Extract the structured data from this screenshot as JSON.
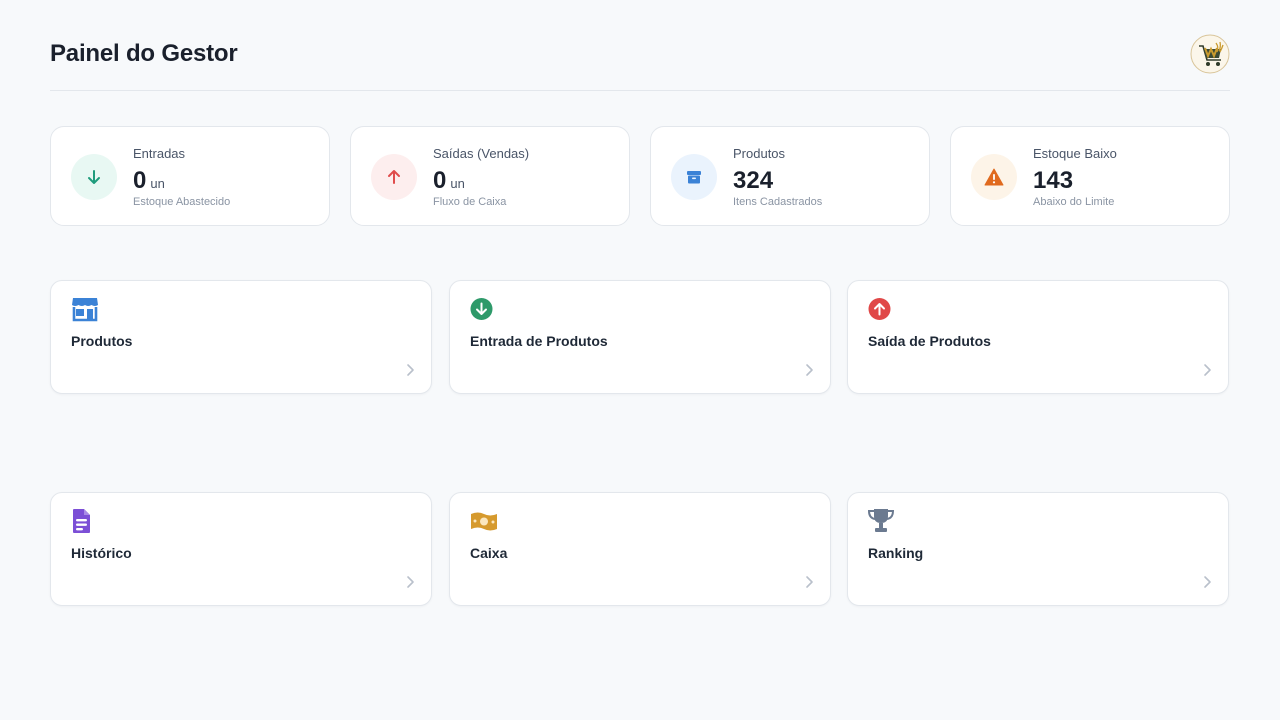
{
  "header": {
    "title": "Painel do Gestor",
    "logo_icon": "shop-cart-logo"
  },
  "stats": [
    {
      "label": "Entradas",
      "value": "0",
      "unit": "un",
      "sub": "Estoque Abastecido",
      "icon": "arrow-down-icon",
      "color": "#1e9c7c",
      "bg": "#e8f8f3"
    },
    {
      "label": "Saídas (Vendas)",
      "value": "0",
      "unit": "un",
      "sub": "Fluxo de Caixa",
      "icon": "arrow-up-icon",
      "color": "#e04c4c",
      "bg": "#fdeeee"
    },
    {
      "label": "Produtos",
      "value": "324",
      "unit": "",
      "sub": "Itens Cadastrados",
      "icon": "box-icon",
      "color": "#3b82d6",
      "bg": "#eaf3fd"
    },
    {
      "label": "Estoque Baixo",
      "value": "143",
      "unit": "",
      "sub": "Abaixo do Limite",
      "icon": "warning-icon",
      "color": "#e06a1e",
      "bg": "#fdf4e8"
    }
  ],
  "menu": [
    {
      "label": "Produtos",
      "icon": "store-icon",
      "color": "#3b82d6"
    },
    {
      "label": "Entrada de Produtos",
      "icon": "arrow-down-circle-icon",
      "color": "#2e9a6a"
    },
    {
      "label": "Saída de Produtos",
      "icon": "arrow-up-circle-icon",
      "color": "#e04848"
    },
    {
      "label": "Histórico",
      "icon": "document-icon",
      "color": "#7c4fd6"
    },
    {
      "label": "Caixa",
      "icon": "money-icon",
      "color": "#d69a2e"
    },
    {
      "label": "Ranking",
      "icon": "trophy-icon",
      "color": "#6b7a90"
    }
  ]
}
